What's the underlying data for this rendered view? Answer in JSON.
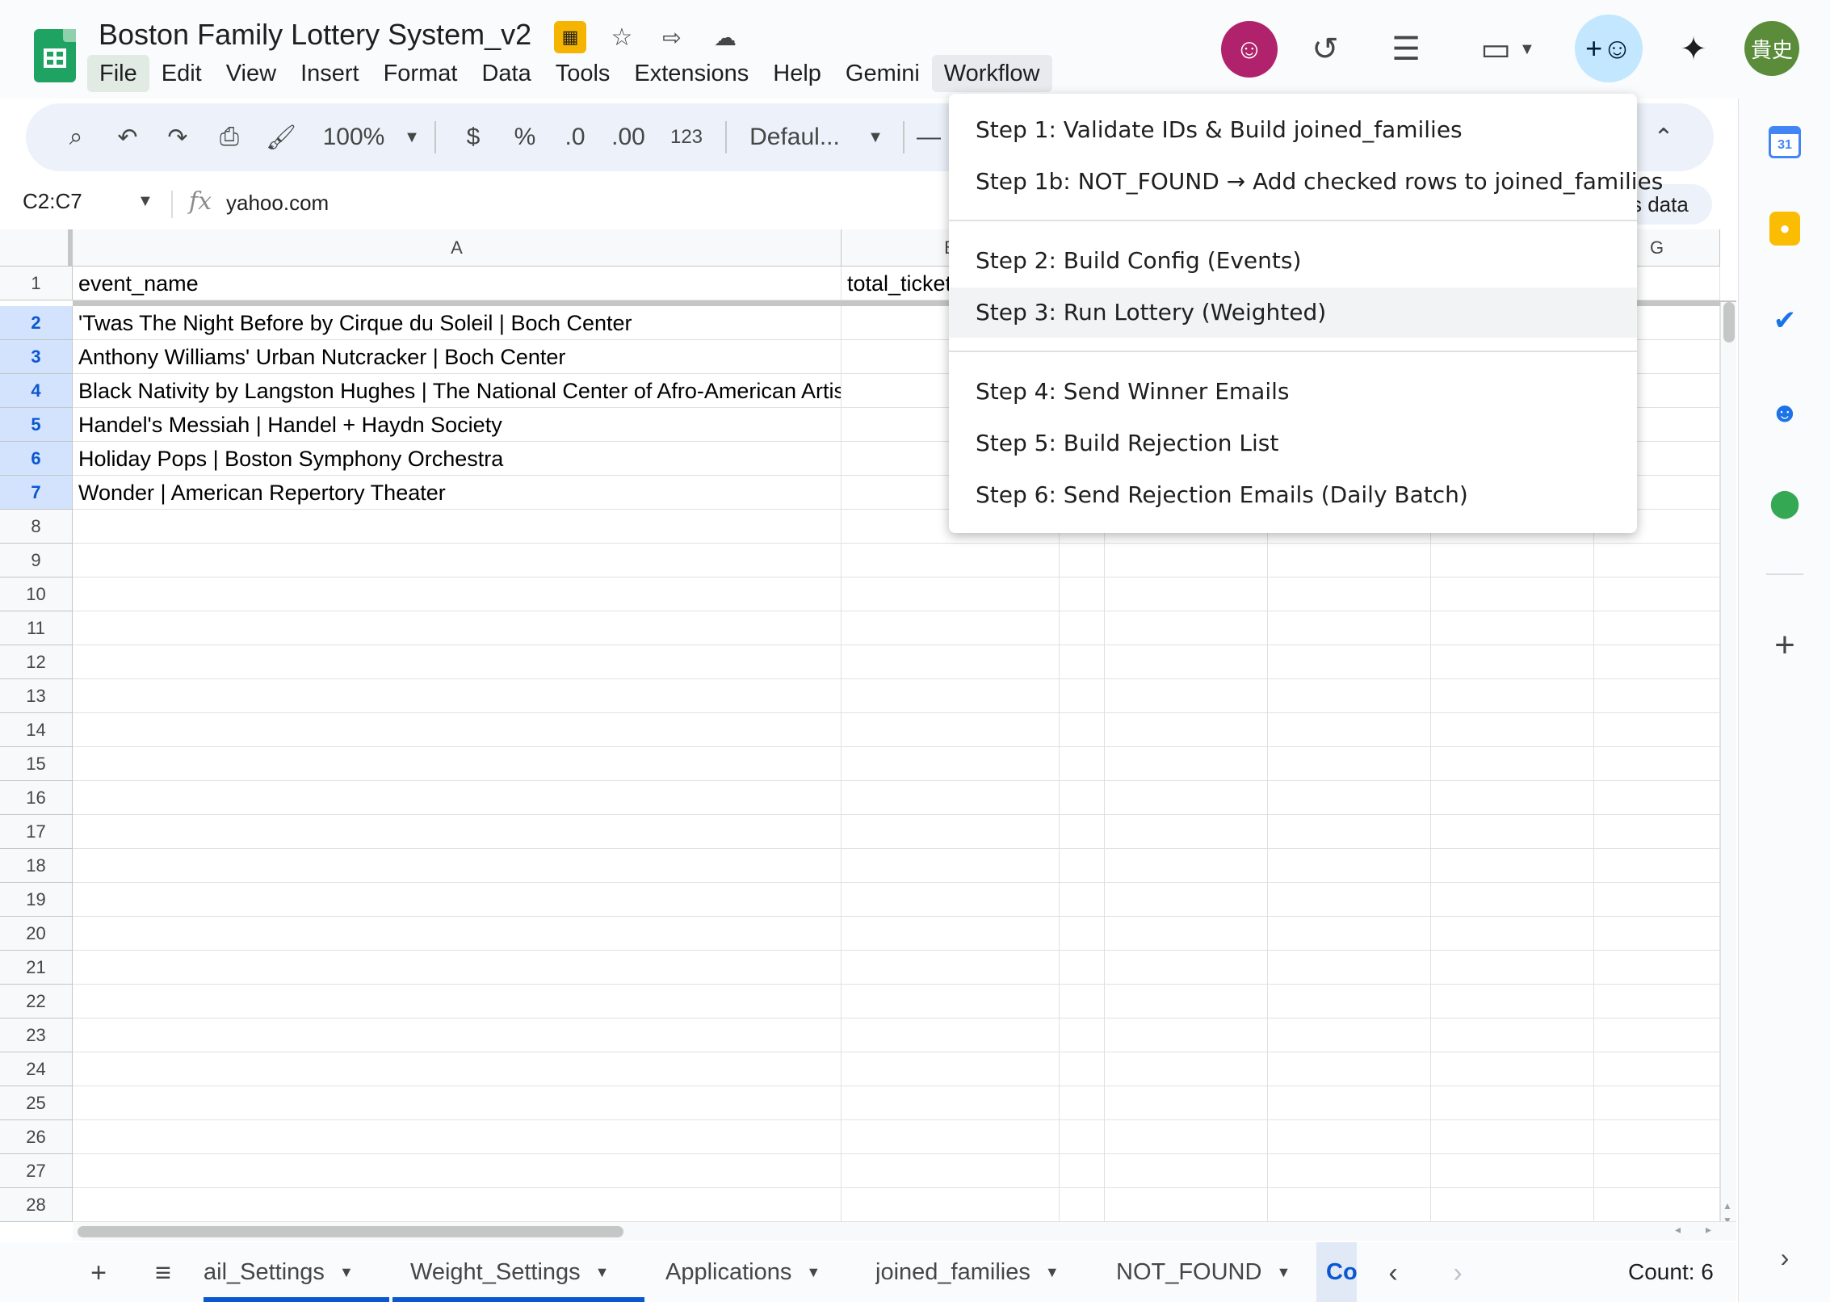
{
  "app": {
    "doc_title": "Boston Family Lottery System_v2",
    "menus": [
      "File",
      "Edit",
      "View",
      "Insert",
      "Format",
      "Data",
      "Tools",
      "Extensions",
      "Help",
      "Gemini",
      "Workflow"
    ],
    "user_initials": "貴史"
  },
  "toolbar": {
    "zoom": "100%",
    "currency": "$",
    "percent": "%",
    "decrease_decimal": ".0",
    "increase_decimal": ".00",
    "number_format": "123",
    "font": "Defaul..."
  },
  "formula_bar": {
    "name_box": "C2:C7",
    "fx": "fx",
    "value": "yahoo.com",
    "explore_label": "s data"
  },
  "grid": {
    "col_a": "A",
    "col_b": "B",
    "col_g": "G",
    "header_row": {
      "a": "event_name",
      "b": "total_tickets"
    },
    "events": [
      "'Twas The Night Before by Cirque du Soleil | Boch Center",
      "Anthony Williams' Urban Nutcracker | Boch Center",
      "Black Nativity by Langston Hughes | The National Center of Afro-American Artists",
      "Handel's Messiah | Handel + Haydn Society",
      "Holiday Pops | Boston Symphony Orchestra",
      "Wonder | American Repertory Theater"
    ],
    "row_numbers": [
      "1",
      "2",
      "3",
      "4",
      "5",
      "6",
      "7",
      "8",
      "9",
      "10",
      "11",
      "12",
      "13",
      "14",
      "15",
      "16",
      "17",
      "18",
      "19",
      "20",
      "21",
      "22",
      "23",
      "24",
      "25",
      "26",
      "27",
      "28"
    ]
  },
  "workflow_menu": {
    "items": [
      "Step 1: Validate IDs & Build joined_families",
      "Step 1b: NOT_FOUND → Add checked rows to joined_families",
      "Step 2: Build Config (Events)",
      "Step 3: Run Lottery (Weighted)",
      "Step 4: Send Winner Emails",
      "Step 5: Build Rejection List",
      "Step 6: Send Rejection Emails (Daily Batch)"
    ],
    "hovered_index": 3
  },
  "sheets": {
    "tabs": [
      "ail_Settings",
      "Weight_Settings",
      "Applications",
      "joined_families",
      "NOT_FOUND",
      "Co"
    ],
    "current_index": 5,
    "count_label": "Count: 6"
  },
  "colors": {
    "accent": "#0b57d0",
    "selection": "#d3e3fd",
    "sheets_green": "#1ea362",
    "share": "#c2e7ff"
  }
}
